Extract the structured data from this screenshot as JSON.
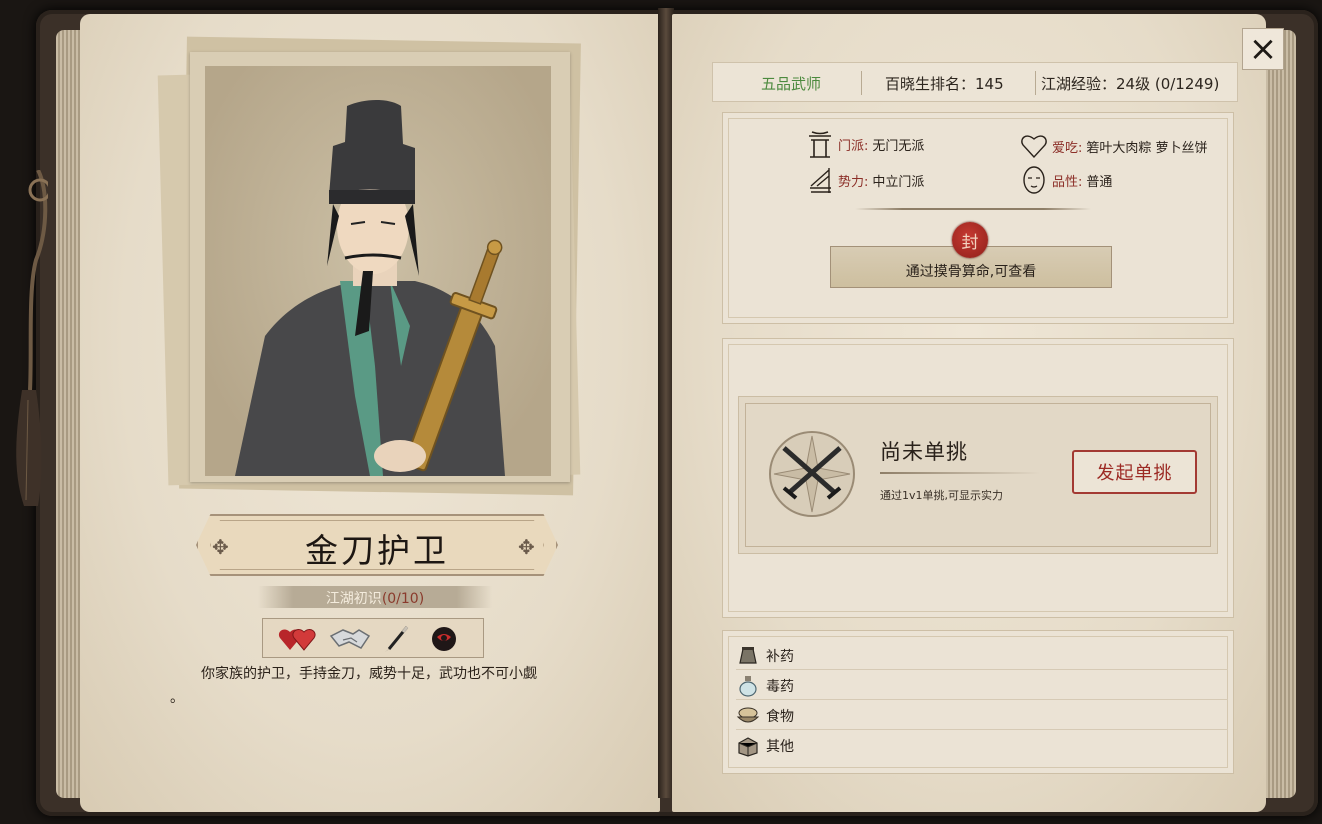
{
  "character": {
    "name": "金刀护卫",
    "relation_label": "江湖初识",
    "relation_count": "(0/10)",
    "description_line1": "你家族的护卫，手持金刀，威势十足，武功也不可小觑",
    "description_line2": "。"
  },
  "traits": [
    {
      "icon": "double-heart-icon"
    },
    {
      "icon": "handshake-icon"
    },
    {
      "icon": "brush-pen-icon"
    },
    {
      "icon": "red-mask-icon"
    }
  ],
  "topbar": {
    "rank": "五品武师",
    "ranking_label": "百晓生排名：145",
    "experience_label": "江湖经验：24级 (0/1249)"
  },
  "attributes": {
    "sect_key": "门派:",
    "sect_value": "无门无派",
    "faction_key": "势力:",
    "faction_value": "中立门派",
    "likes_key": "爱吃:",
    "likes_value": "箬叶大肉粽 萝卜丝饼",
    "character_key": "品性:",
    "character_value": "普通"
  },
  "sealed": {
    "seal_text": "封",
    "hint": "通过摸骨算命,可查看"
  },
  "duel": {
    "title": "尚未单挑",
    "subtitle": "通过1v1单挑,可显示实力",
    "button_label": "发起单挑"
  },
  "bag": [
    {
      "label": "补药",
      "icon": "medicine-pouch-icon"
    },
    {
      "label": "毒药",
      "icon": "poison-bottle-icon"
    },
    {
      "label": "食物",
      "icon": "food-bowl-icon"
    },
    {
      "label": "其他",
      "icon": "misc-box-icon"
    }
  ],
  "close_label": "×",
  "colors": {
    "accent_red": "#9c2a24",
    "rank_green": "#4c8a3e",
    "parchment": "#ebe3d5"
  }
}
